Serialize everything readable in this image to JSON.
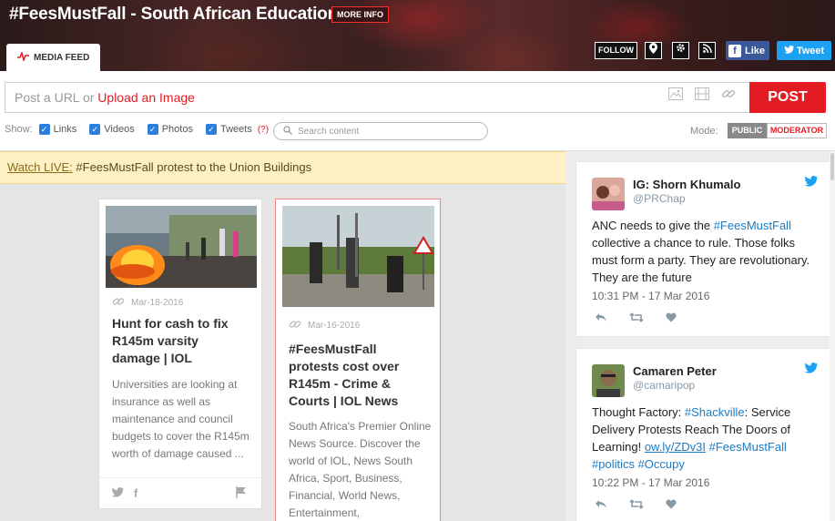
{
  "header": {
    "title": "#FeesMustFall - South African Education",
    "more_info": "MORE INFO",
    "tab_label": "MEDIA FEED",
    "follow": "FOLLOW",
    "facebook": "Like",
    "twitter": "Tweet"
  },
  "post": {
    "prompt": "Post a URL or ",
    "upload": "Upload an Image",
    "button": "POST"
  },
  "filters": {
    "show": "Show:",
    "items": [
      "Links",
      "Videos",
      "Photos",
      "Tweets"
    ],
    "help": "(?)",
    "search_placeholder": "Search content",
    "mode_label": "Mode:",
    "public": "PUBLIC",
    "moderator": "MODERATOR"
  },
  "banner": {
    "watch": "Watch LIVE:",
    "text": " #FeesMustFall protest to the Union Buildings"
  },
  "cards": [
    {
      "date": "Mar-18-2016",
      "title": "Hunt for cash to fix R145m varsity damage | IOL",
      "description": "Universities are looking at insurance as well as maintenance and council budgets to cover the R145m worth of damage caused ..."
    },
    {
      "date": "Mar-16-2016",
      "title": "#FeesMustFall protests cost over R145m - Crime & Courts | IOL News",
      "description": "South Africa's Premier Online News Source. Discover the world of IOL, News South Africa, Sport, Business, Financial, World News, Entertainment,"
    }
  ],
  "tweets": [
    {
      "name": "IG: Shorn Khumalo",
      "handle": "@PRChap",
      "text_a": "ANC needs to give the ",
      "tag_a": "#FeesMustFall",
      "text_b": " collective a chance to rule. Those folks must form a party. They are revolutionary. They are the future",
      "time": "10:31 PM - 17 Mar 2016"
    },
    {
      "name": "Camaren Peter",
      "handle": "@camaripop",
      "text_a": "Thought Factory: ",
      "tag_a": "#Shackville",
      "text_b": ": Service Delivery Protests Reach The Doors of Learning! ",
      "link": "ow.ly/ZDv3I",
      "tag_b": " #FeesMustFall",
      "tag_c": "#politics",
      "tag_d": " #Occupy",
      "time": "10:22 PM - 17 Mar 2016"
    }
  ],
  "colors": {
    "accent": "#e31b23",
    "twitter": "#1da1f2",
    "facebook": "#3b5998",
    "banner": "#fdf0c4"
  },
  "icons": [
    "pulse-icon",
    "map-pin-icon",
    "gear-icon",
    "rss-icon",
    "image-icon",
    "film-icon",
    "link-icon",
    "search-icon",
    "twitter-bird-icon",
    "reply-icon",
    "retweet-icon",
    "heart-icon",
    "flag-icon",
    "facebook-icon"
  ]
}
